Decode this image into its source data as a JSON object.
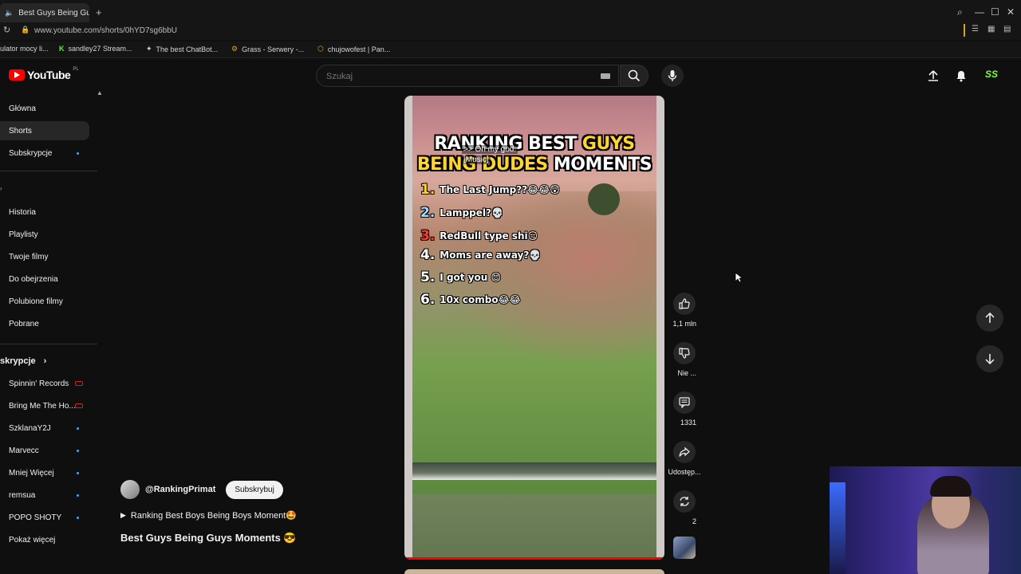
{
  "browser": {
    "tab_title": "Best Guys Being Guy",
    "url": "www.youtube.com/shorts/0hYD7sg6bbU",
    "bookmarks": [
      "ulator mocy li...",
      "sandley27 Stream...",
      "The best ChatBot...",
      "Grass - Serwery -...",
      "chujowofest | Pan..."
    ]
  },
  "header": {
    "logo": "YouTube",
    "country": "PL",
    "search_placeholder": "Szukaj"
  },
  "sidebar": {
    "main": [
      "Główna",
      "Shorts",
      "Subskrypcje"
    ],
    "you": [
      "Historia",
      "Playlisty",
      "Twoje filmy",
      "Do obejrzenia",
      "Polubione filmy",
      "Pobrane"
    ],
    "subs_heading": "skrypcje",
    "subs": [
      "Spinnin' Records",
      "Bring Me The Ho...",
      "SzklanaY2J",
      "Marvecc",
      "Mniej Więcej",
      "remsua",
      "POPO SHOTY",
      "Pokaż więcej"
    ]
  },
  "video": {
    "title_line1_white": "RANKING BEST",
    "title_line1_yellow": "GUYS",
    "title_line2_yellow": "BEING DUDES",
    "title_line2_white": "MOMENTS",
    "caption1": ">> Oh my god.",
    "caption2": "[Music]",
    "ranks": [
      {
        "num": "1.",
        "text": "The Last Jump??😂😂😲",
        "color": "#ffd52e"
      },
      {
        "num": "2.",
        "text": "Lamppel?💀",
        "color": "#9fdcff"
      },
      {
        "num": "3.",
        "text": "RedBull type shi😏",
        "color": "#ff3b30"
      },
      {
        "num": "4.",
        "text": "Moms are away?💀",
        "color": "#ffffff"
      },
      {
        "num": "5.",
        "text": "I got you 😊",
        "color": "#ffffff"
      },
      {
        "num": "6.",
        "text": "10x combo😂😂",
        "color": "#ffffff"
      }
    ]
  },
  "actions": {
    "likes": "1,1 mln",
    "dislike": "Nie ...",
    "comments": "1331",
    "share": "Udostęp...",
    "remix": "2"
  },
  "channel": {
    "handle": "@RankingPrimat",
    "subscribe": "Subskrybuj",
    "playlist": "Ranking Best Boys Being Boys Moment🤩",
    "short_title": "Best Guys Being Guys Moments 😎"
  }
}
